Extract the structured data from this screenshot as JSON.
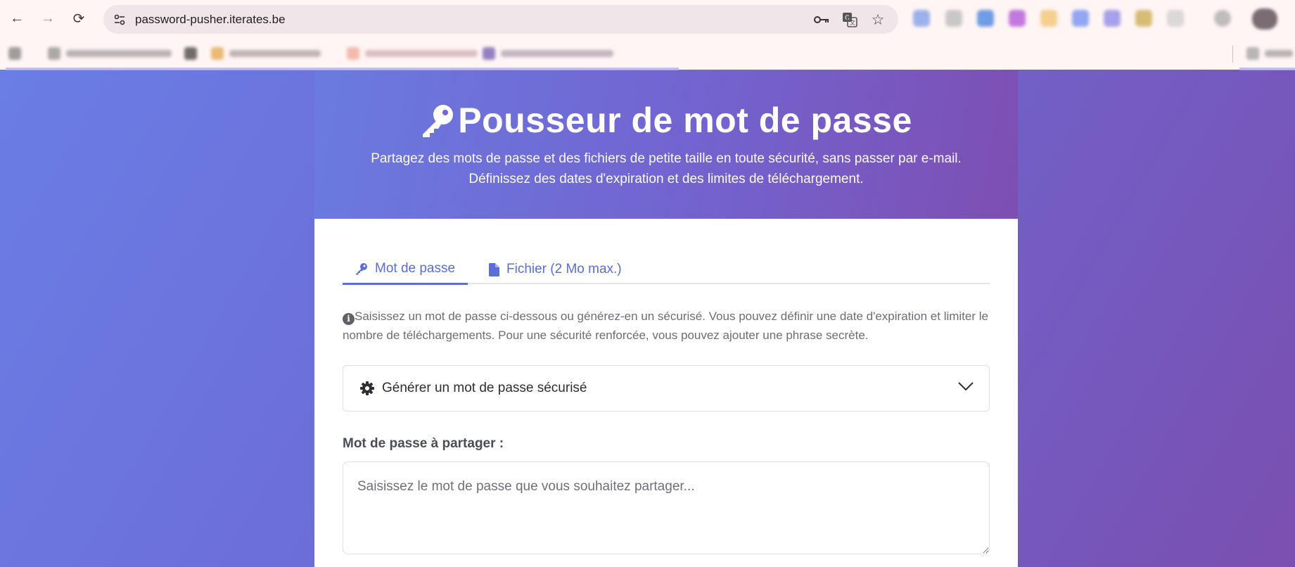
{
  "browser": {
    "url": "password-pusher.iterates.be",
    "nav": {
      "back": "←",
      "forward": "→",
      "reload": "⟳"
    },
    "omnibox_icons": [
      "key-icon",
      "translate-icon",
      "star-icon"
    ]
  },
  "hero": {
    "title": "Pousseur de mot de passe",
    "subtitle_line1": "Partagez des mots de passe et des fichiers de petite taille en toute sécurité, sans passer par e-mail.",
    "subtitle_line2": "Définissez des dates d'expiration et des limites de téléchargement."
  },
  "tabs": [
    {
      "label": "Mot de passe",
      "icon": "key-icon",
      "active": true
    },
    {
      "label": "Fichier (2 Mo max.)",
      "icon": "file-icon",
      "active": false
    }
  ],
  "info_text": "Saisissez un mot de passe ci-dessous ou générez-en un sécurisé. Vous pouvez définir une date d'expiration et limiter le nombre de téléchargements. Pour une sécurité renforcée, vous pouvez ajouter une phrase secrète.",
  "generator": {
    "label": "Générer un mot de passe sécurisé",
    "icon": "gear-icon"
  },
  "password_field": {
    "label": "Mot de passe à partager :",
    "placeholder": "Saisissez le mot de passe que vous souhaitez partager..."
  },
  "colors": {
    "accent": "#5b6dd6",
    "hero_start": "#6a7be0",
    "hero_end": "#7d4fb2"
  }
}
